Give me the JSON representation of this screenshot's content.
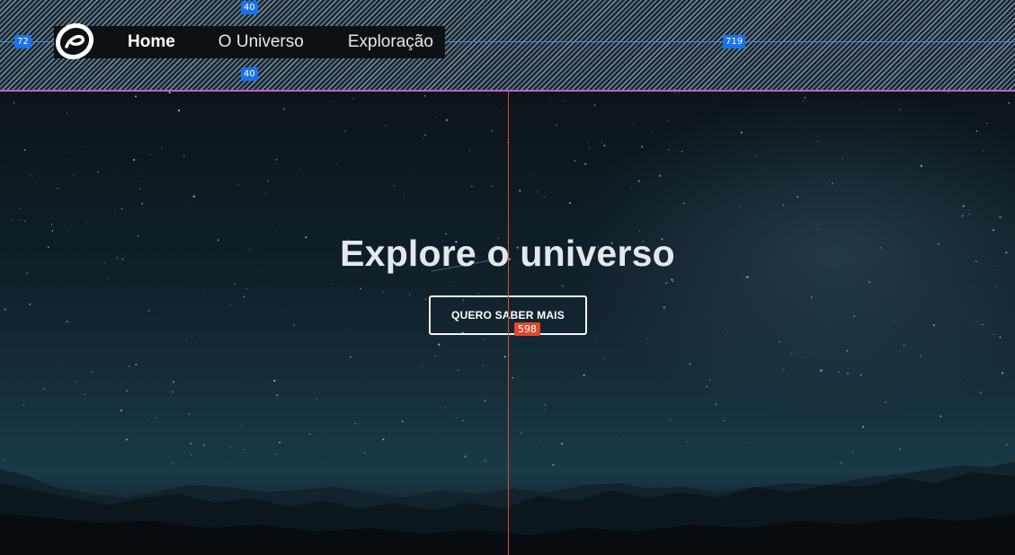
{
  "nav": {
    "logo_icon": "swirl-logo-icon",
    "items": [
      {
        "label": "Home",
        "active": true
      },
      {
        "label": "O Universo",
        "active": false
      },
      {
        "label": "Exploração",
        "active": false
      }
    ]
  },
  "hero": {
    "title": "Explore o universo",
    "cta_label": "QUERO SABER MAIS"
  },
  "measurements": {
    "top_gap": "40",
    "bottom_gap": "40",
    "left_offset": "72",
    "right_offset": "719",
    "button_offset": "598"
  },
  "colors": {
    "guide_blue": "#3b8fe6",
    "guide_red": "#e0492e",
    "header_border": "#c75ad8"
  }
}
